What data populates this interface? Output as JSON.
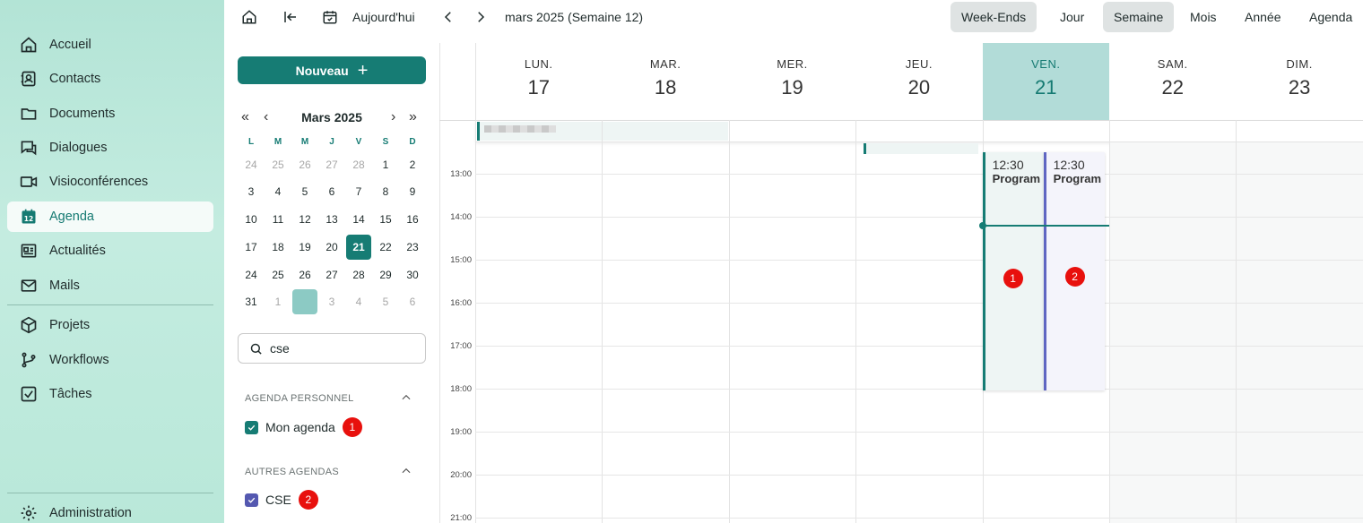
{
  "nav": {
    "items": [
      {
        "label": "Accueil",
        "icon": "home-icon"
      },
      {
        "label": "Contacts",
        "icon": "contacts-icon"
      },
      {
        "label": "Documents",
        "icon": "folder-icon"
      },
      {
        "label": "Dialogues",
        "icon": "chat-icon"
      },
      {
        "label": "Visioconférences",
        "icon": "video-icon"
      },
      {
        "label": "Agenda",
        "icon": "calendar-icon",
        "active": true
      },
      {
        "label": "Actualités",
        "icon": "news-icon"
      },
      {
        "label": "Mails",
        "icon": "mail-icon"
      },
      {
        "label": "Projets",
        "icon": "box-icon"
      },
      {
        "label": "Workflows",
        "icon": "workflow-icon"
      },
      {
        "label": "Tâches",
        "icon": "checkbox-icon"
      },
      {
        "label": "Administration",
        "icon": "gear-icon"
      }
    ]
  },
  "toolbar": {
    "today_label": "Aujourd'hui",
    "period_label": "mars 2025 (Semaine 12)",
    "views": [
      "Week-Ends",
      "Jour",
      "Semaine",
      "Mois",
      "Année",
      "Agenda"
    ],
    "active_view": "Semaine",
    "weekends_toggle_on": true
  },
  "panel": {
    "new_button": "Nouveau",
    "mini_cal": {
      "title": "Mars 2025",
      "dow": [
        "L",
        "M",
        "M",
        "J",
        "V",
        "S",
        "D"
      ],
      "weeks": [
        [
          "24",
          "25",
          "26",
          "27",
          "28",
          "1",
          "2"
        ],
        [
          "3",
          "4",
          "5",
          "6",
          "7",
          "8",
          "9"
        ],
        [
          "10",
          "11",
          "12",
          "13",
          "14",
          "15",
          "16"
        ],
        [
          "17",
          "18",
          "19",
          "20",
          "21",
          "22",
          "23"
        ],
        [
          "24",
          "25",
          "26",
          "27",
          "28",
          "29",
          "30"
        ],
        [
          "31",
          "1",
          "2",
          "3",
          "4",
          "5",
          "6"
        ]
      ],
      "today": "21"
    },
    "search_value": "cse",
    "sections": [
      {
        "title": "AGENDA PERSONNEL",
        "items": [
          {
            "label": "Mon agenda",
            "badge": "1",
            "color": "#167c74",
            "checked": true
          }
        ]
      },
      {
        "title": "AUTRES AGENDAS",
        "items": [
          {
            "label": "CSE",
            "badge": "2",
            "color": "#5458b0",
            "checked": true
          }
        ]
      }
    ]
  },
  "week": {
    "days": [
      {
        "name": "LUN.",
        "num": "17"
      },
      {
        "name": "MAR.",
        "num": "18"
      },
      {
        "name": "MER.",
        "num": "19"
      },
      {
        "name": "JEU.",
        "num": "20"
      },
      {
        "name": "VEN.",
        "num": "21",
        "today": true
      },
      {
        "name": "SAM.",
        "num": "22"
      },
      {
        "name": "DIM.",
        "num": "23"
      }
    ],
    "hours": [
      "13:00",
      "14:00",
      "15:00",
      "16:00",
      "17:00",
      "18:00",
      "19:00",
      "20:00",
      "21:00"
    ],
    "events": [
      {
        "time": "12:30",
        "title": "Program",
        "badge": "1",
        "calendar": "Mon agenda",
        "accent": "#167c74",
        "bg": "#eef5f4"
      },
      {
        "time": "12:30",
        "title": "Program",
        "badge": "2",
        "calendar": "CSE",
        "accent": "#5f66c2",
        "bg": "#f4f4fb"
      }
    ]
  }
}
